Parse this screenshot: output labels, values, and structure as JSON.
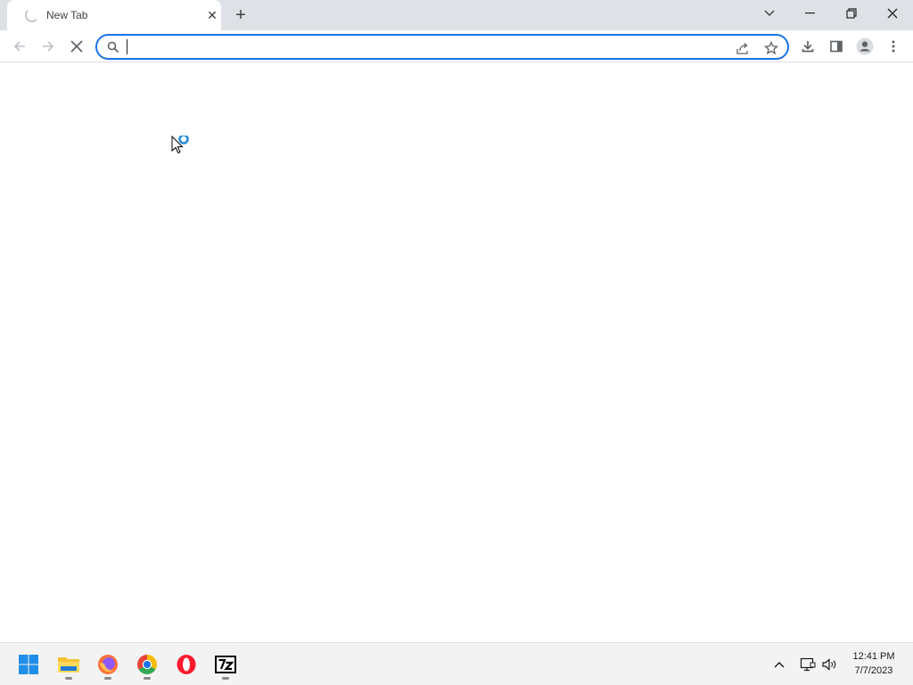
{
  "browser": {
    "tab": {
      "title": "New Tab"
    },
    "omnibox": {
      "value": "",
      "placeholder": ""
    }
  },
  "taskbar": {
    "apps": [
      "start-icon",
      "file-explorer-icon",
      "firefox-icon",
      "chrome-icon",
      "opera-icon",
      "7zip-icon"
    ],
    "clock": {
      "time": "12:41 PM",
      "date": "7/7/2023"
    }
  },
  "colors": {
    "accent": "#1a73e8",
    "tabstrip": "#dee1e6",
    "taskbar": "#f3f3f3"
  }
}
